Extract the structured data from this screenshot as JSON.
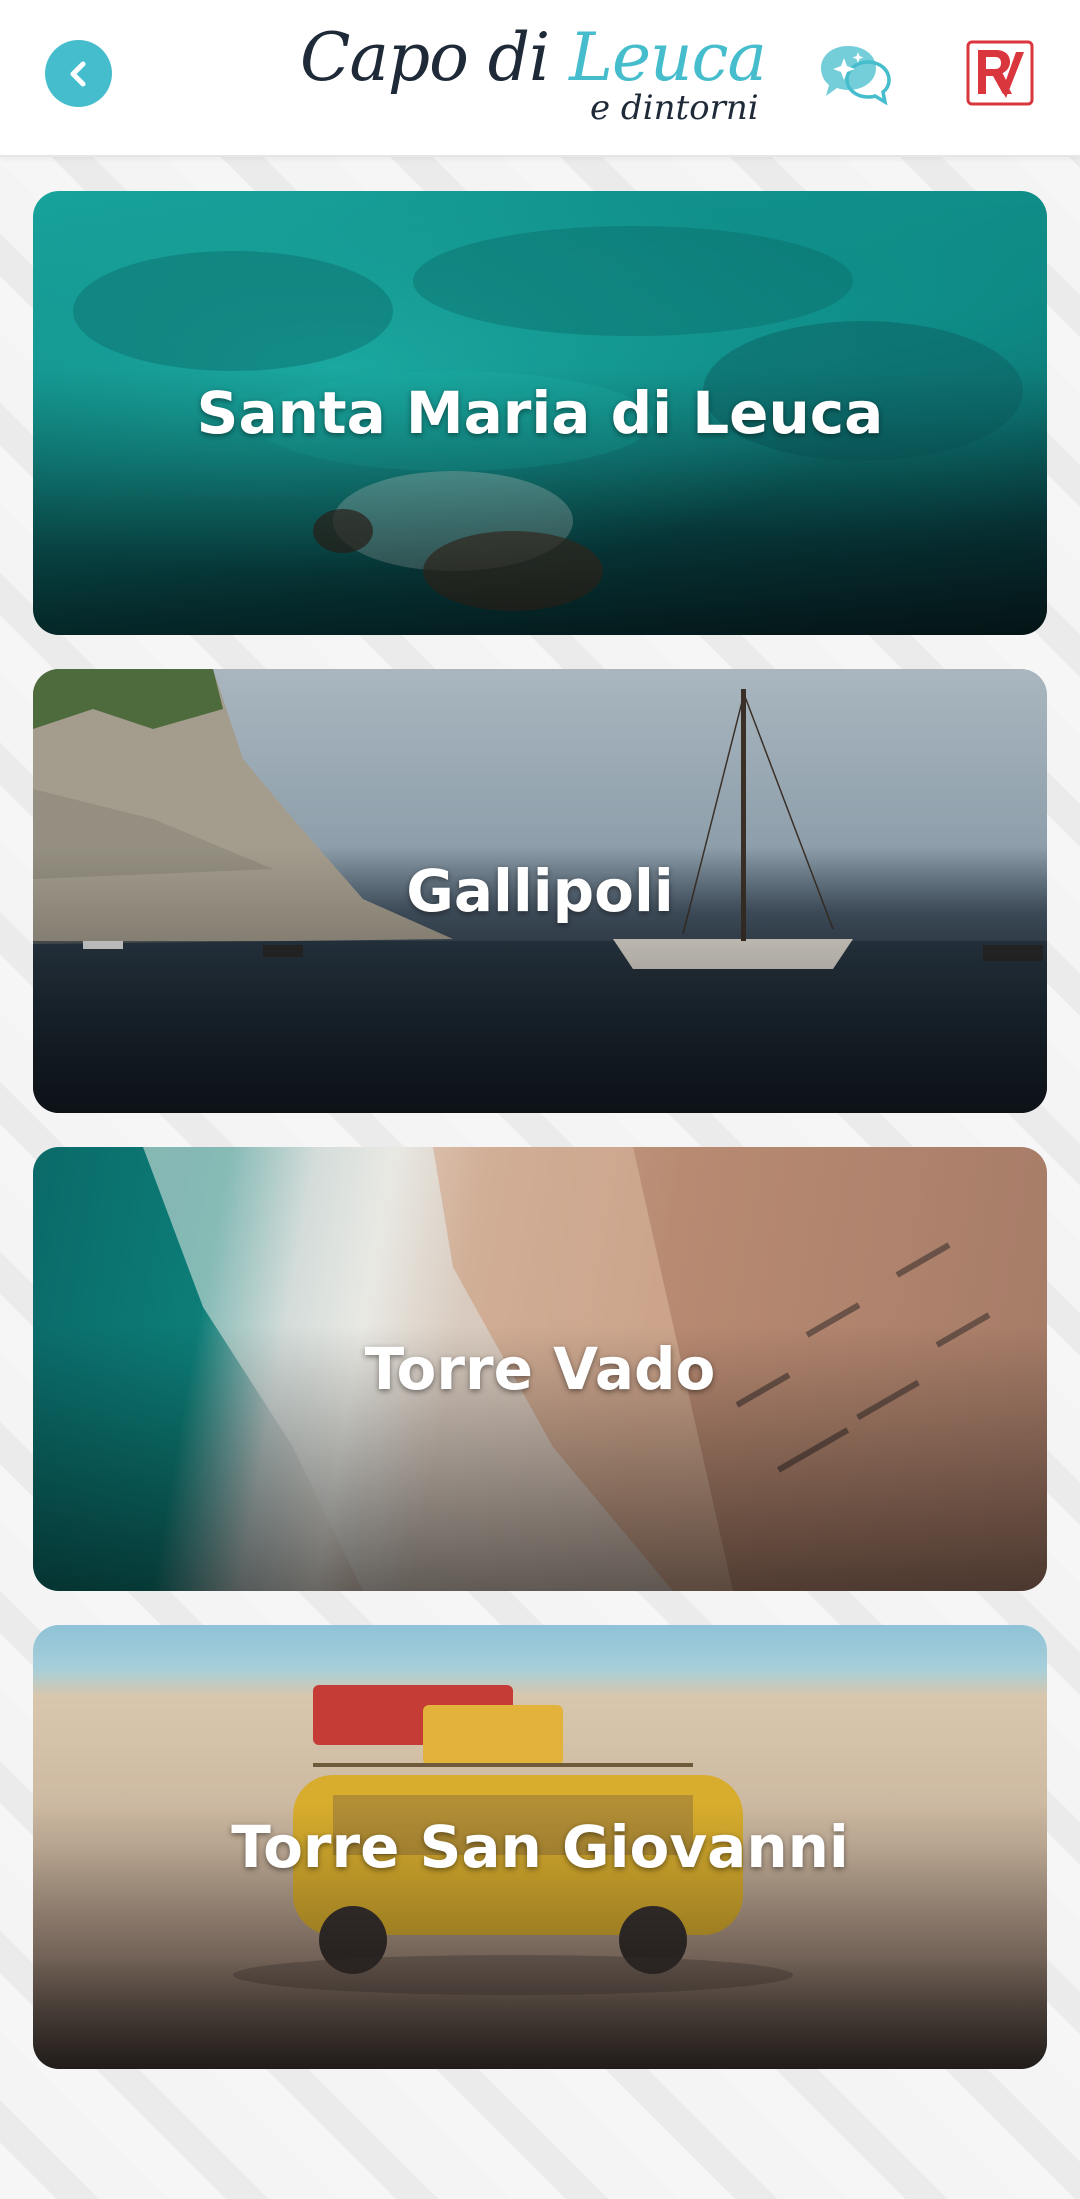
{
  "header": {
    "back_icon": "chevron-left-icon",
    "logo": {
      "word1": "Capo di ",
      "word2": "Leuca",
      "subtitle": "e dintorni"
    },
    "chat_icon": "sparkle-chat-icon",
    "brand_icon": "rv-logo-icon"
  },
  "colors": {
    "accent": "#46bdcc",
    "logo_dark": "#1e2a38",
    "brand_red": "#d9363e"
  },
  "destinations": [
    {
      "title": "Santa Maria di Leuca"
    },
    {
      "title": "Gallipoli"
    },
    {
      "title": "Torre Vado"
    },
    {
      "title": "Torre San Giovanni"
    }
  ]
}
